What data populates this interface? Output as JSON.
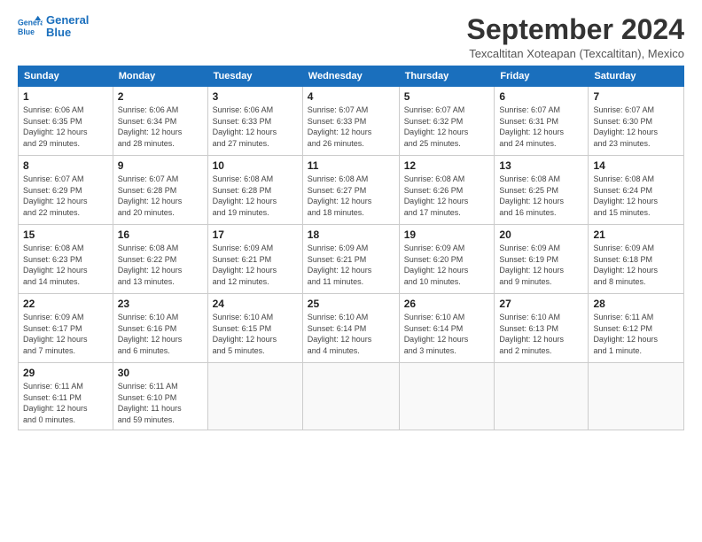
{
  "logo": {
    "line1": "General",
    "line2": "Blue"
  },
  "title": "September 2024",
  "subtitle": "Texcaltitan Xoteapan (Texcaltitan), Mexico",
  "days_header": [
    "Sunday",
    "Monday",
    "Tuesday",
    "Wednesday",
    "Thursday",
    "Friday",
    "Saturday"
  ],
  "weeks": [
    [
      {
        "day": "1",
        "info": "Sunrise: 6:06 AM\nSunset: 6:35 PM\nDaylight: 12 hours\nand 29 minutes."
      },
      {
        "day": "2",
        "info": "Sunrise: 6:06 AM\nSunset: 6:34 PM\nDaylight: 12 hours\nand 28 minutes."
      },
      {
        "day": "3",
        "info": "Sunrise: 6:06 AM\nSunset: 6:33 PM\nDaylight: 12 hours\nand 27 minutes."
      },
      {
        "day": "4",
        "info": "Sunrise: 6:07 AM\nSunset: 6:33 PM\nDaylight: 12 hours\nand 26 minutes."
      },
      {
        "day": "5",
        "info": "Sunrise: 6:07 AM\nSunset: 6:32 PM\nDaylight: 12 hours\nand 25 minutes."
      },
      {
        "day": "6",
        "info": "Sunrise: 6:07 AM\nSunset: 6:31 PM\nDaylight: 12 hours\nand 24 minutes."
      },
      {
        "day": "7",
        "info": "Sunrise: 6:07 AM\nSunset: 6:30 PM\nDaylight: 12 hours\nand 23 minutes."
      }
    ],
    [
      {
        "day": "8",
        "info": "Sunrise: 6:07 AM\nSunset: 6:29 PM\nDaylight: 12 hours\nand 22 minutes."
      },
      {
        "day": "9",
        "info": "Sunrise: 6:07 AM\nSunset: 6:28 PM\nDaylight: 12 hours\nand 20 minutes."
      },
      {
        "day": "10",
        "info": "Sunrise: 6:08 AM\nSunset: 6:28 PM\nDaylight: 12 hours\nand 19 minutes."
      },
      {
        "day": "11",
        "info": "Sunrise: 6:08 AM\nSunset: 6:27 PM\nDaylight: 12 hours\nand 18 minutes."
      },
      {
        "day": "12",
        "info": "Sunrise: 6:08 AM\nSunset: 6:26 PM\nDaylight: 12 hours\nand 17 minutes."
      },
      {
        "day": "13",
        "info": "Sunrise: 6:08 AM\nSunset: 6:25 PM\nDaylight: 12 hours\nand 16 minutes."
      },
      {
        "day": "14",
        "info": "Sunrise: 6:08 AM\nSunset: 6:24 PM\nDaylight: 12 hours\nand 15 minutes."
      }
    ],
    [
      {
        "day": "15",
        "info": "Sunrise: 6:08 AM\nSunset: 6:23 PM\nDaylight: 12 hours\nand 14 minutes."
      },
      {
        "day": "16",
        "info": "Sunrise: 6:08 AM\nSunset: 6:22 PM\nDaylight: 12 hours\nand 13 minutes."
      },
      {
        "day": "17",
        "info": "Sunrise: 6:09 AM\nSunset: 6:21 PM\nDaylight: 12 hours\nand 12 minutes."
      },
      {
        "day": "18",
        "info": "Sunrise: 6:09 AM\nSunset: 6:21 PM\nDaylight: 12 hours\nand 11 minutes."
      },
      {
        "day": "19",
        "info": "Sunrise: 6:09 AM\nSunset: 6:20 PM\nDaylight: 12 hours\nand 10 minutes."
      },
      {
        "day": "20",
        "info": "Sunrise: 6:09 AM\nSunset: 6:19 PM\nDaylight: 12 hours\nand 9 minutes."
      },
      {
        "day": "21",
        "info": "Sunrise: 6:09 AM\nSunset: 6:18 PM\nDaylight: 12 hours\nand 8 minutes."
      }
    ],
    [
      {
        "day": "22",
        "info": "Sunrise: 6:09 AM\nSunset: 6:17 PM\nDaylight: 12 hours\nand 7 minutes."
      },
      {
        "day": "23",
        "info": "Sunrise: 6:10 AM\nSunset: 6:16 PM\nDaylight: 12 hours\nand 6 minutes."
      },
      {
        "day": "24",
        "info": "Sunrise: 6:10 AM\nSunset: 6:15 PM\nDaylight: 12 hours\nand 5 minutes."
      },
      {
        "day": "25",
        "info": "Sunrise: 6:10 AM\nSunset: 6:14 PM\nDaylight: 12 hours\nand 4 minutes."
      },
      {
        "day": "26",
        "info": "Sunrise: 6:10 AM\nSunset: 6:14 PM\nDaylight: 12 hours\nand 3 minutes."
      },
      {
        "day": "27",
        "info": "Sunrise: 6:10 AM\nSunset: 6:13 PM\nDaylight: 12 hours\nand 2 minutes."
      },
      {
        "day": "28",
        "info": "Sunrise: 6:11 AM\nSunset: 6:12 PM\nDaylight: 12 hours\nand 1 minute."
      }
    ],
    [
      {
        "day": "29",
        "info": "Sunrise: 6:11 AM\nSunset: 6:11 PM\nDaylight: 12 hours\nand 0 minutes."
      },
      {
        "day": "30",
        "info": "Sunrise: 6:11 AM\nSunset: 6:10 PM\nDaylight: 11 hours\nand 59 minutes."
      },
      null,
      null,
      null,
      null,
      null
    ]
  ]
}
